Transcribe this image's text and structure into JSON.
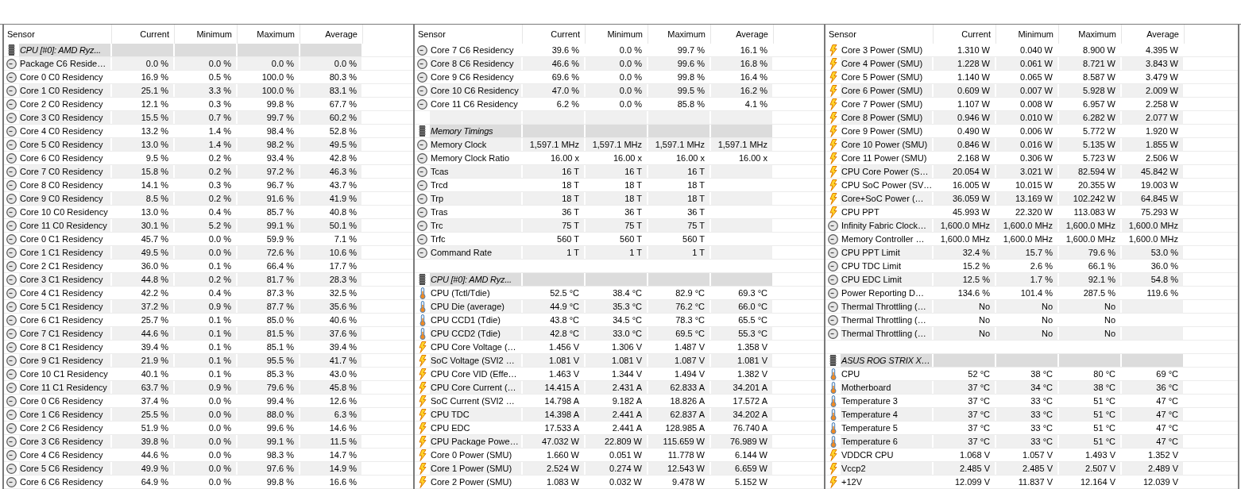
{
  "panels": [
    {
      "columns": [
        "Sensor",
        "Current",
        "Minimum",
        "Maximum",
        "Average"
      ],
      "rows": [
        {
          "kind": "group",
          "name": "CPU [#0]: AMD Ryz..."
        },
        {
          "kind": "clock",
          "name": "Package C6 Reside…",
          "values": [
            "0.0 %",
            "0.0 %",
            "0.0 %",
            "0.0 %"
          ]
        },
        {
          "kind": "clock",
          "name": "Core 0 C0 Residency",
          "values": [
            "16.9 %",
            "0.5 %",
            "100.0 %",
            "80.3 %"
          ]
        },
        {
          "kind": "clock",
          "name": "Core 1 C0 Residency",
          "values": [
            "25.1 %",
            "3.3 %",
            "100.0 %",
            "83.1 %"
          ]
        },
        {
          "kind": "clock",
          "name": "Core 2 C0 Residency",
          "values": [
            "12.1 %",
            "0.3 %",
            "99.8 %",
            "67.7 %"
          ]
        },
        {
          "kind": "clock",
          "name": "Core 3 C0 Residency",
          "values": [
            "15.5 %",
            "0.7 %",
            "99.7 %",
            "60.2 %"
          ]
        },
        {
          "kind": "clock",
          "name": "Core 4 C0 Residency",
          "values": [
            "13.2 %",
            "1.4 %",
            "98.4 %",
            "52.8 %"
          ]
        },
        {
          "kind": "clock",
          "name": "Core 5 C0 Residency",
          "values": [
            "13.0 %",
            "1.4 %",
            "98.2 %",
            "49.5 %"
          ]
        },
        {
          "kind": "clock",
          "name": "Core 6 C0 Residency",
          "values": [
            "9.5 %",
            "0.2 %",
            "93.4 %",
            "42.8 %"
          ]
        },
        {
          "kind": "clock",
          "name": "Core 7 C0 Residency",
          "values": [
            "15.8 %",
            "0.2 %",
            "97.2 %",
            "46.3 %"
          ]
        },
        {
          "kind": "clock",
          "name": "Core 8 C0 Residency",
          "values": [
            "14.1 %",
            "0.3 %",
            "96.7 %",
            "43.7 %"
          ]
        },
        {
          "kind": "clock",
          "name": "Core 9 C0 Residency",
          "values": [
            "8.5 %",
            "0.2 %",
            "91.6 %",
            "41.9 %"
          ]
        },
        {
          "kind": "clock",
          "name": "Core 10 C0 Residency",
          "values": [
            "13.0 %",
            "0.4 %",
            "85.7 %",
            "40.8 %"
          ]
        },
        {
          "kind": "clock",
          "name": "Core 11 C0 Residency",
          "values": [
            "30.1 %",
            "5.2 %",
            "99.1 %",
            "50.1 %"
          ]
        },
        {
          "kind": "clock",
          "name": "Core 0 C1 Residency",
          "values": [
            "45.7 %",
            "0.0 %",
            "59.9 %",
            "7.1 %"
          ]
        },
        {
          "kind": "clock",
          "name": "Core 1 C1 Residency",
          "values": [
            "49.5 %",
            "0.0 %",
            "72.6 %",
            "10.6 %"
          ]
        },
        {
          "kind": "clock",
          "name": "Core 2 C1 Residency",
          "values": [
            "36.0 %",
            "0.1 %",
            "66.4 %",
            "17.7 %"
          ]
        },
        {
          "kind": "clock",
          "name": "Core 3 C1 Residency",
          "values": [
            "44.8 %",
            "0.2 %",
            "81.7 %",
            "28.3 %"
          ]
        },
        {
          "kind": "clock",
          "name": "Core 4 C1 Residency",
          "values": [
            "42.2 %",
            "0.4 %",
            "87.3 %",
            "32.5 %"
          ]
        },
        {
          "kind": "clock",
          "name": "Core 5 C1 Residency",
          "values": [
            "37.2 %",
            "0.9 %",
            "87.7 %",
            "35.6 %"
          ]
        },
        {
          "kind": "clock",
          "name": "Core 6 C1 Residency",
          "values": [
            "25.7 %",
            "0.1 %",
            "85.0 %",
            "40.6 %"
          ]
        },
        {
          "kind": "clock",
          "name": "Core 7 C1 Residency",
          "values": [
            "44.6 %",
            "0.1 %",
            "81.5 %",
            "37.6 %"
          ]
        },
        {
          "kind": "clock",
          "name": "Core 8 C1 Residency",
          "values": [
            "39.4 %",
            "0.1 %",
            "85.1 %",
            "39.4 %"
          ]
        },
        {
          "kind": "clock",
          "name": "Core 9 C1 Residency",
          "values": [
            "21.9 %",
            "0.1 %",
            "95.5 %",
            "41.7 %"
          ]
        },
        {
          "kind": "clock",
          "name": "Core 10 C1 Residency",
          "values": [
            "40.1 %",
            "0.1 %",
            "85.3 %",
            "43.0 %"
          ]
        },
        {
          "kind": "clock",
          "name": "Core 11 C1 Residency",
          "values": [
            "63.7 %",
            "0.9 %",
            "79.6 %",
            "45.8 %"
          ]
        },
        {
          "kind": "clock",
          "name": "Core 0 C6 Residency",
          "values": [
            "37.4 %",
            "0.0 %",
            "99.4 %",
            "12.6 %"
          ]
        },
        {
          "kind": "clock",
          "name": "Core 1 C6 Residency",
          "values": [
            "25.5 %",
            "0.0 %",
            "88.0 %",
            "6.3 %"
          ]
        },
        {
          "kind": "clock",
          "name": "Core 2 C6 Residency",
          "values": [
            "51.9 %",
            "0.0 %",
            "99.6 %",
            "14.6 %"
          ]
        },
        {
          "kind": "clock",
          "name": "Core 3 C6 Residency",
          "values": [
            "39.8 %",
            "0.0 %",
            "99.1 %",
            "11.5 %"
          ]
        },
        {
          "kind": "clock",
          "name": "Core 4 C6 Residency",
          "values": [
            "44.6 %",
            "0.0 %",
            "98.3 %",
            "14.7 %"
          ]
        },
        {
          "kind": "clock",
          "name": "Core 5 C6 Residency",
          "values": [
            "49.9 %",
            "0.0 %",
            "97.6 %",
            "14.9 %"
          ]
        },
        {
          "kind": "clock",
          "name": "Core 6 C6 Residency",
          "values": [
            "64.9 %",
            "0.0 %",
            "99.8 %",
            "16.6 %"
          ]
        }
      ]
    },
    {
      "columns": [
        "Sensor",
        "Current",
        "Minimum",
        "Maximum",
        "Average"
      ],
      "rows": [
        {
          "kind": "clock",
          "name": "Core 7 C6 Residency",
          "values": [
            "39.6 %",
            "0.0 %",
            "99.7 %",
            "16.1 %"
          ]
        },
        {
          "kind": "clock",
          "name": "Core 8 C6 Residency",
          "values": [
            "46.6 %",
            "0.0 %",
            "99.6 %",
            "16.8 %"
          ]
        },
        {
          "kind": "clock",
          "name": "Core 9 C6 Residency",
          "values": [
            "69.6 %",
            "0.0 %",
            "99.8 %",
            "16.4 %"
          ]
        },
        {
          "kind": "clock",
          "name": "Core 10 C6 Residency",
          "values": [
            "47.0 %",
            "0.0 %",
            "99.5 %",
            "16.2 %"
          ]
        },
        {
          "kind": "clock",
          "name": "Core 11 C6 Residency",
          "values": [
            "6.2 %",
            "0.0 %",
            "85.8 %",
            "4.1 %"
          ]
        },
        {
          "kind": "blank"
        },
        {
          "kind": "group",
          "name": "Memory Timings"
        },
        {
          "kind": "clock",
          "name": "Memory Clock",
          "values": [
            "1,597.1 MHz",
            "1,597.1 MHz",
            "1,597.1 MHz",
            "1,597.1 MHz"
          ]
        },
        {
          "kind": "clock",
          "name": "Memory Clock Ratio",
          "values": [
            "16.00 x",
            "16.00 x",
            "16.00 x",
            "16.00 x"
          ]
        },
        {
          "kind": "clock",
          "name": "Tcas",
          "values": [
            "16 T",
            "16 T",
            "16 T"
          ]
        },
        {
          "kind": "clock",
          "name": "Trcd",
          "values": [
            "18 T",
            "18 T",
            "18 T"
          ]
        },
        {
          "kind": "clock",
          "name": "Trp",
          "values": [
            "18 T",
            "18 T",
            "18 T"
          ]
        },
        {
          "kind": "clock",
          "name": "Tras",
          "values": [
            "36 T",
            "36 T",
            "36 T"
          ]
        },
        {
          "kind": "clock",
          "name": "Trc",
          "values": [
            "75 T",
            "75 T",
            "75 T"
          ]
        },
        {
          "kind": "clock",
          "name": "Trfc",
          "values": [
            "560 T",
            "560 T",
            "560 T"
          ]
        },
        {
          "kind": "clock",
          "name": "Command Rate",
          "values": [
            "1 T",
            "1 T",
            "1 T"
          ]
        },
        {
          "kind": "blank"
        },
        {
          "kind": "group",
          "name": "CPU [#0]: AMD Ryz..."
        },
        {
          "kind": "thermometer",
          "name": "CPU (Tctl/Tdie)",
          "values": [
            "52.5 °C",
            "38.4 °C",
            "82.9 °C",
            "69.3 °C"
          ]
        },
        {
          "kind": "thermometer",
          "name": "CPU Die (average)",
          "values": [
            "44.9 °C",
            "35.3 °C",
            "76.2 °C",
            "66.0 °C"
          ]
        },
        {
          "kind": "thermometer",
          "name": "CPU CCD1 (Tdie)",
          "values": [
            "43.8 °C",
            "34.5 °C",
            "78.3 °C",
            "65.5 °C"
          ]
        },
        {
          "kind": "thermometer",
          "name": "CPU CCD2 (Tdie)",
          "values": [
            "42.8 °C",
            "33.0 °C",
            "69.5 °C",
            "55.3 °C"
          ]
        },
        {
          "kind": "bolt",
          "name": "CPU Core Voltage (…",
          "values": [
            "1.456 V",
            "1.306 V",
            "1.487 V",
            "1.358 V"
          ]
        },
        {
          "kind": "bolt",
          "name": "SoC Voltage (SVI2 …",
          "values": [
            "1.081 V",
            "1.081 V",
            "1.087 V",
            "1.081 V"
          ]
        },
        {
          "kind": "bolt",
          "name": "CPU Core VID (Effe…",
          "values": [
            "1.463 V",
            "1.344 V",
            "1.494 V",
            "1.382 V"
          ]
        },
        {
          "kind": "bolt",
          "name": "CPU Core Current (…",
          "values": [
            "14.415 A",
            "2.431 A",
            "62.833 A",
            "34.201 A"
          ]
        },
        {
          "kind": "bolt",
          "name": "SoC Current (SVI2 …",
          "values": [
            "14.798 A",
            "9.182 A",
            "18.826 A",
            "17.572 A"
          ]
        },
        {
          "kind": "bolt",
          "name": "CPU TDC",
          "values": [
            "14.398 A",
            "2.441 A",
            "62.837 A",
            "34.202 A"
          ]
        },
        {
          "kind": "bolt",
          "name": "CPU EDC",
          "values": [
            "17.533 A",
            "2.441 A",
            "128.985 A",
            "76.740 A"
          ]
        },
        {
          "kind": "bolt",
          "name": "CPU Package Powe…",
          "values": [
            "47.032 W",
            "22.809 W",
            "115.659 W",
            "76.989 W"
          ]
        },
        {
          "kind": "bolt",
          "name": "Core 0 Power (SMU)",
          "values": [
            "1.660 W",
            "0.051 W",
            "11.778 W",
            "6.144 W"
          ]
        },
        {
          "kind": "bolt",
          "name": "Core 1 Power (SMU)",
          "values": [
            "2.524 W",
            "0.274 W",
            "12.543 W",
            "6.659 W"
          ]
        },
        {
          "kind": "bolt",
          "name": "Core 2 Power (SMU)",
          "values": [
            "1.083 W",
            "0.032 W",
            "9.478 W",
            "5.152 W"
          ]
        }
      ]
    },
    {
      "columns": [
        "Sensor",
        "Current",
        "Minimum",
        "Maximum",
        "Average"
      ],
      "rows": [
        {
          "kind": "bolt",
          "name": "Core 3 Power (SMU)",
          "values": [
            "1.310 W",
            "0.040 W",
            "8.900 W",
            "4.395 W"
          ]
        },
        {
          "kind": "bolt",
          "name": "Core 4 Power (SMU)",
          "values": [
            "1.228 W",
            "0.061 W",
            "8.721 W",
            "3.843 W"
          ]
        },
        {
          "kind": "bolt",
          "name": "Core 5 Power (SMU)",
          "values": [
            "1.140 W",
            "0.065 W",
            "8.587 W",
            "3.479 W"
          ]
        },
        {
          "kind": "bolt",
          "name": "Core 6 Power (SMU)",
          "values": [
            "0.609 W",
            "0.007 W",
            "5.928 W",
            "2.009 W"
          ]
        },
        {
          "kind": "bolt",
          "name": "Core 7 Power (SMU)",
          "values": [
            "1.107 W",
            "0.008 W",
            "6.957 W",
            "2.258 W"
          ]
        },
        {
          "kind": "bolt",
          "name": "Core 8 Power (SMU)",
          "values": [
            "0.946 W",
            "0.010 W",
            "6.282 W",
            "2.077 W"
          ]
        },
        {
          "kind": "bolt",
          "name": "Core 9 Power (SMU)",
          "values": [
            "0.490 W",
            "0.006 W",
            "5.772 W",
            "1.920 W"
          ]
        },
        {
          "kind": "bolt",
          "name": "Core 10 Power (SMU)",
          "values": [
            "0.846 W",
            "0.016 W",
            "5.135 W",
            "1.855 W"
          ]
        },
        {
          "kind": "bolt",
          "name": "Core 11 Power (SMU)",
          "values": [
            "2.168 W",
            "0.306 W",
            "5.723 W",
            "2.506 W"
          ]
        },
        {
          "kind": "bolt",
          "name": "CPU Core Power (S…",
          "values": [
            "20.054 W",
            "3.021 W",
            "82.594 W",
            "45.842 W"
          ]
        },
        {
          "kind": "bolt",
          "name": "CPU SoC Power (SV…",
          "values": [
            "16.005 W",
            "10.015 W",
            "20.355 W",
            "19.003 W"
          ]
        },
        {
          "kind": "bolt",
          "name": "Core+SoC Power (…",
          "values": [
            "36.059 W",
            "13.169 W",
            "102.242 W",
            "64.845 W"
          ]
        },
        {
          "kind": "bolt",
          "name": "CPU PPT",
          "values": [
            "45.993 W",
            "22.320 W",
            "113.083 W",
            "75.293 W"
          ]
        },
        {
          "kind": "clock",
          "name": "Infinity Fabric Clock…",
          "values": [
            "1,600.0 MHz",
            "1,600.0 MHz",
            "1,600.0 MHz",
            "1,600.0 MHz"
          ]
        },
        {
          "kind": "clock",
          "name": "Memory Controller …",
          "values": [
            "1,600.0 MHz",
            "1,600.0 MHz",
            "1,600.0 MHz",
            "1,600.0 MHz"
          ]
        },
        {
          "kind": "clock",
          "name": "CPU PPT Limit",
          "values": [
            "32.4 %",
            "15.7 %",
            "79.6 %",
            "53.0 %"
          ]
        },
        {
          "kind": "clock",
          "name": "CPU TDC Limit",
          "values": [
            "15.2 %",
            "2.6 %",
            "66.1 %",
            "36.0 %"
          ]
        },
        {
          "kind": "clock",
          "name": "CPU EDC Limit",
          "values": [
            "12.5 %",
            "1.7 %",
            "92.1 %",
            "54.8 %"
          ]
        },
        {
          "kind": "clock",
          "name": "Power Reporting D…",
          "values": [
            "134.6 %",
            "101.4 %",
            "287.5 %",
            "119.6 %"
          ]
        },
        {
          "kind": "clock",
          "name": "Thermal Throttling (…",
          "values": [
            "No",
            "No",
            "No"
          ]
        },
        {
          "kind": "clock",
          "name": "Thermal Throttling (…",
          "values": [
            "No",
            "No",
            "No"
          ]
        },
        {
          "kind": "clock",
          "name": "Thermal Throttling (…",
          "values": [
            "No",
            "No",
            "No"
          ]
        },
        {
          "kind": "blank"
        },
        {
          "kind": "group",
          "name": "ASUS ROG STRIX X…"
        },
        {
          "kind": "thermometer",
          "name": "CPU",
          "values": [
            "52 °C",
            "38 °C",
            "80 °C",
            "69 °C"
          ]
        },
        {
          "kind": "thermometer",
          "name": "Motherboard",
          "values": [
            "37 °C",
            "34 °C",
            "38 °C",
            "36 °C"
          ]
        },
        {
          "kind": "thermometer",
          "name": "Temperature 3",
          "values": [
            "37 °C",
            "33 °C",
            "51 °C",
            "47 °C"
          ]
        },
        {
          "kind": "thermometer",
          "name": "Temperature 4",
          "values": [
            "37 °C",
            "33 °C",
            "51 °C",
            "47 °C"
          ]
        },
        {
          "kind": "thermometer",
          "name": "Temperature 5",
          "values": [
            "37 °C",
            "33 °C",
            "51 °C",
            "47 °C"
          ]
        },
        {
          "kind": "thermometer",
          "name": "Temperature 6",
          "values": [
            "37 °C",
            "33 °C",
            "51 °C",
            "47 °C"
          ]
        },
        {
          "kind": "bolt",
          "name": "VDDCR CPU",
          "values": [
            "1.068 V",
            "1.057 V",
            "1.493 V",
            "1.352 V"
          ]
        },
        {
          "kind": "bolt",
          "name": "Vccp2",
          "values": [
            "2.485 V",
            "2.485 V",
            "2.507 V",
            "2.489 V"
          ]
        },
        {
          "kind": "bolt",
          "name": "+12V",
          "values": [
            "12.099 V",
            "11.837 V",
            "12.164 V",
            "12.039 V"
          ]
        }
      ]
    }
  ]
}
